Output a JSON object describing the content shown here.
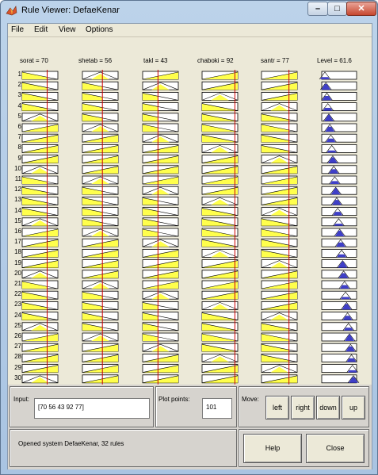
{
  "window": {
    "title": "Rule Viewer: DefaeKenar"
  },
  "menu": [
    {
      "label": "File"
    },
    {
      "label": "Edit"
    },
    {
      "label": "View"
    },
    {
      "label": "Options"
    }
  ],
  "inputs": [
    {
      "name": "sorat",
      "value": 70,
      "title": "sorat = 70",
      "range": [
        0,
        100
      ]
    },
    {
      "name": "shetab",
      "value": 56,
      "title": "shetab = 56",
      "range": [
        0,
        100
      ]
    },
    {
      "name": "takl",
      "value": 43,
      "title": "takl = 43",
      "range": [
        0,
        100
      ]
    },
    {
      "name": "chaboki",
      "value": 92,
      "title": "chaboki = 92",
      "range": [
        0,
        100
      ]
    },
    {
      "name": "santr",
      "value": 77,
      "title": "santr = 77",
      "range": [
        0,
        100
      ]
    }
  ],
  "output": {
    "name": "Level",
    "value": 61.6,
    "title": "Level = 61.6"
  },
  "rule_numbers": [
    "1",
    "2",
    "3",
    "4",
    "5",
    "6",
    "7",
    "8",
    "9",
    "10",
    "11",
    "12",
    "13",
    "14",
    "15",
    "16",
    "17",
    "18",
    "19",
    "20",
    "21",
    "22",
    "23",
    "24",
    "25",
    "26",
    "27",
    "28",
    "29",
    "30"
  ],
  "controls": {
    "input_label": "Input:",
    "input_value": "[70 56 43 92 77]",
    "plot_points_label": "Plot points:",
    "plot_points_value": "101",
    "move_label": "Move:",
    "move_buttons": [
      "left",
      "right",
      "down",
      "up"
    ],
    "status": "Opened system DefaeKenar, 32 rules",
    "help_label": "Help",
    "close_label": "Close"
  },
  "colors": {
    "fill_yellow": "#ffff4c",
    "fill_blue": "#3f3fc8",
    "index_line": "#cc0000",
    "window_frame": "#a9c4e2",
    "client_bg": "#ece9d8"
  }
}
